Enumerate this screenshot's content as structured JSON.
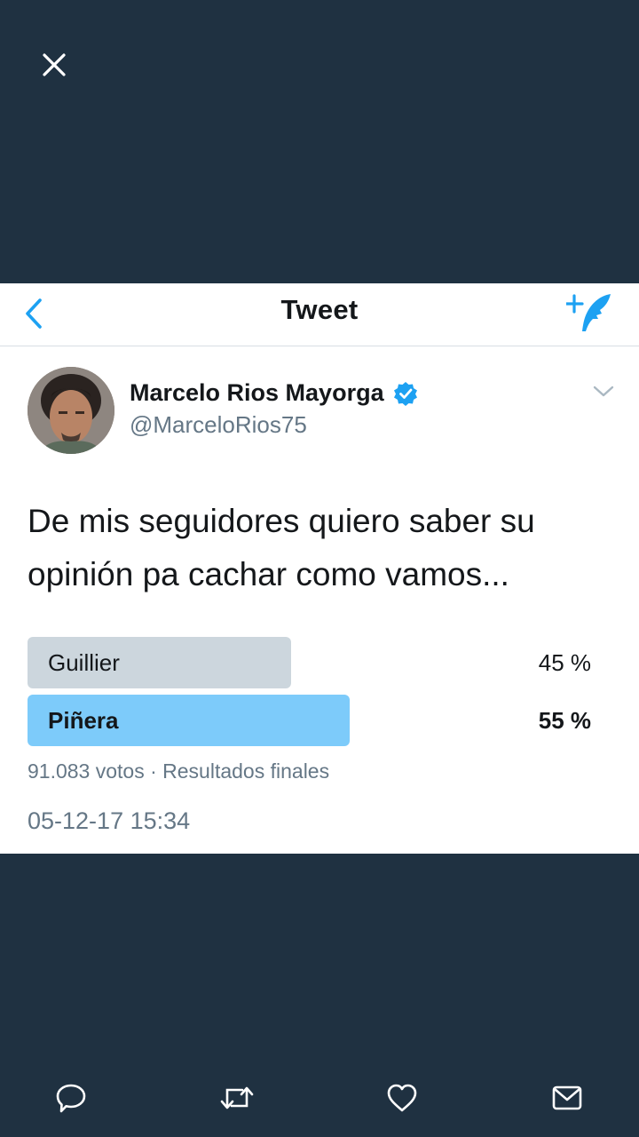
{
  "nav": {
    "title": "Tweet"
  },
  "tweet": {
    "author_name": "Marcelo Rios Mayorga",
    "handle": "@MarceloRios75",
    "text": "De mis seguidores quiero saber su opinión pa cachar como vamos...",
    "timestamp": "05-12-17 15:34"
  },
  "poll": {
    "options": [
      {
        "label": "Guillier",
        "percent_text": "45 %",
        "value": 45,
        "winner": false,
        "color": "#ccd6dd"
      },
      {
        "label": "Piñera",
        "percent_text": "55 %",
        "value": 55,
        "winner": true,
        "color": "#7dcbfa"
      }
    ],
    "meta": "91.083 votos · Resultados finales"
  },
  "colors": {
    "background": "#1f3141",
    "accent": "#1da1f2",
    "verified": "#1da1f2"
  },
  "icons": [
    "close-icon",
    "back-chevron-icon",
    "compose-icon",
    "verified-badge-icon",
    "chevron-down-icon",
    "reply-icon",
    "retweet-icon",
    "like-icon",
    "message-icon"
  ]
}
